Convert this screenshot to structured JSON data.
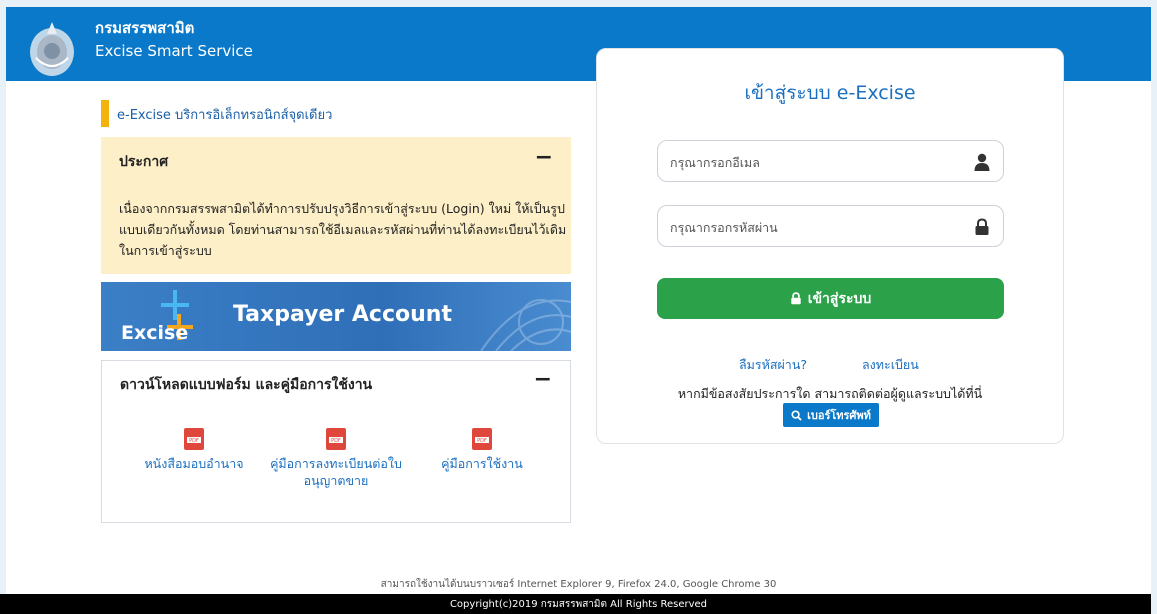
{
  "header": {
    "org_name_th": "กรมสรรพสามิต",
    "org_name_en": "Excise Smart Service"
  },
  "sidebar": {
    "tagline": "e-Excise บริการอิเล็กทรอนิกส์จุดเดียว",
    "announcement": {
      "title": "ประกาศ",
      "toggle": "−",
      "body": "เนื่องจากกรมสรรพสามิตได้ทำการปรับปรุงวิธีการเข้าสู่ระบบ (Login) ใหม่ ให้เป็นรูปแบบเดียวกันทั้งหมด โดยท่านสามารถใช้อีเมลและรหัสผ่านที่ท่านได้ลงทะเบียนไว้เดิมในการเข้าสู่ระบบ"
    },
    "banner": {
      "brand": "Excise",
      "title": "Taxpayer Account"
    },
    "downloads": {
      "title": "ดาวน์โหลดแบบฟอร์ม และคู่มือการใช้งาน",
      "toggle": "−",
      "items": [
        {
          "label": "หนังสือมอบอำนาจ",
          "icon": "pdf-icon"
        },
        {
          "label": "คู่มือการลงทะเบียนต่อใบอนุญาตขาย",
          "icon": "pdf-icon"
        },
        {
          "label": "คู่มือการใช้งาน",
          "icon": "pdf-icon"
        }
      ]
    }
  },
  "login": {
    "title": "เข้าสู่ระบบ e-Excise",
    "email_placeholder": "กรุณากรอกอีเมล",
    "password_placeholder": "กรุณากรอกรหัสผ่าน",
    "submit_label": "เข้าสู่ระบบ",
    "forgot_password": "ลืมรหัสผ่าน?",
    "register": "ลงทะเบียน",
    "help_text": "หากมีข้อสงสัยประการใด สามารถติดต่อผู้ดูแลระบบได้ที่นี่",
    "phone_button": "เบอร์โทรศัพท์"
  },
  "footer": {
    "browsers": "สามารถใช้งานได้บนบราวเซอร์ Internet Explorer 9, Firefox 24.0, Google Chrome 30",
    "copyright": "Copyright(c)2019 กรมสรรพสามิต All Rights Reserved"
  },
  "colors": {
    "header_blue": "#0a79c9",
    "accent_yellow": "#f2b30c",
    "announcement_bg": "#fdefc8",
    "login_green": "#2ba24a",
    "link_blue": "#1a6fc0"
  }
}
